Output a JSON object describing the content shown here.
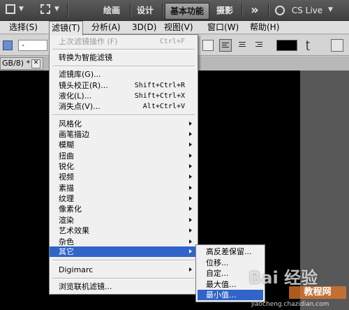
{
  "workspace_bar": {
    "items": [
      "绘画",
      "设计",
      "基本功能",
      "摄影"
    ],
    "overflow_label": "»",
    "cs_live": "CS Live"
  },
  "menu_bar": [
    "选择(S)",
    "滤镜(T)",
    "分析(A)",
    "3D(D)",
    "视图(V)",
    "窗口(W)",
    "帮助(H)"
  ],
  "options_bar": {
    "font_field": "-"
  },
  "document_tab": "GB/8) * ",
  "filter_menu": {
    "last_filter": {
      "label": "上次滤镜操作 (F)",
      "shortcut": "Ctrl+F"
    },
    "smart_filter": "转换为智能滤镜",
    "group_a": [
      {
        "label": "滤镜库(G)...",
        "shortcut": ""
      },
      {
        "label": "镜头校正(R)...",
        "shortcut": "Shift+Ctrl+R"
      },
      {
        "label": "液化(L)...",
        "shortcut": "Shift+Ctrl+X"
      },
      {
        "label": "消失点(V)...",
        "shortcut": "Alt+Ctrl+V"
      }
    ],
    "group_b": [
      "风格化",
      "画笔描边",
      "模糊",
      "扭曲",
      "锐化",
      "视频",
      "素描",
      "纹理",
      "像素化",
      "渲染",
      "艺术效果",
      "杂色",
      "其它"
    ],
    "digimarc": "Digimarc",
    "browse_online": "浏览联机滤镜..."
  },
  "other_submenu": [
    "高反差保留...",
    "位移...",
    "自定...",
    "最大值...",
    "最小值..."
  ],
  "watermark": {
    "main": "Bai 经验",
    "sub": "教程网",
    "url": "jiaocheng.chazidian.com"
  },
  "colors": {
    "highlight": "#3064c8",
    "menu_bg": "#f0f0f0",
    "workspace_bar": "#4a4a4a"
  }
}
